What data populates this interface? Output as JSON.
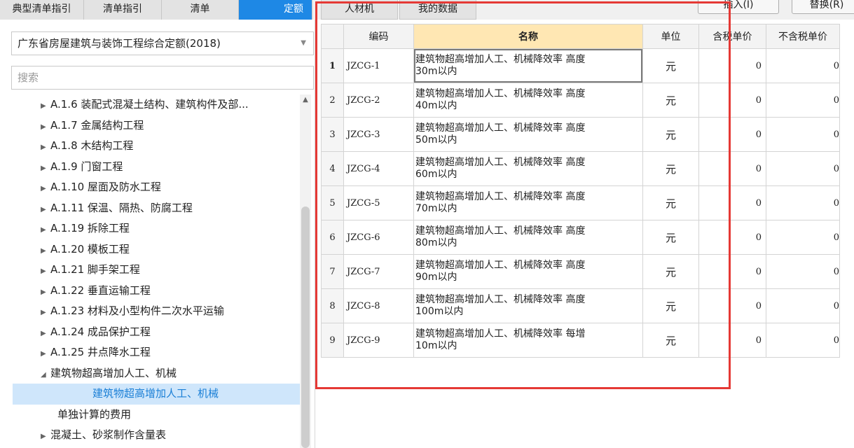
{
  "tabs_left": [
    "典型清单指引",
    "清单指引",
    "清单",
    "定额"
  ],
  "tabs_right": [
    "人材机",
    "我的数据"
  ],
  "buttons": {
    "insert": "插入(I)",
    "replace": "替换(R)"
  },
  "quota_library": {
    "selected": "广东省房屋建筑与装饰工程综合定额(2018)"
  },
  "search": {
    "placeholder": "搜索"
  },
  "tree": [
    {
      "label": "A.1.6 装配式混凝土结构、建筑构件及部...",
      "expandable": true
    },
    {
      "label": "A.1.7 金属结构工程",
      "expandable": true
    },
    {
      "label": "A.1.8 木结构工程",
      "expandable": true
    },
    {
      "label": "A.1.9 门窗工程",
      "expandable": true
    },
    {
      "label": "A.1.10 屋面及防水工程",
      "expandable": true
    },
    {
      "label": "A.1.11 保温、隔热、防腐工程",
      "expandable": true
    },
    {
      "label": "A.1.19 拆除工程",
      "expandable": true
    },
    {
      "label": "A.1.20 模板工程",
      "expandable": true
    },
    {
      "label": "A.1.21 脚手架工程",
      "expandable": true
    },
    {
      "label": "A.1.22 垂直运输工程",
      "expandable": true
    },
    {
      "label": "A.1.23 材料及小型构件二次水平运输",
      "expandable": true
    },
    {
      "label": "A.1.24 成品保护工程",
      "expandable": true
    },
    {
      "label": "A.1.25 井点降水工程",
      "expandable": true
    },
    {
      "label": "建筑物超高增加人工、机械",
      "expanded": true
    },
    {
      "label": "建筑物超高增加人工、机械",
      "selected": true
    },
    {
      "label": "单独计算的费用"
    },
    {
      "label": "混凝土、砂浆制作含量表",
      "expandable": true
    }
  ],
  "grid": {
    "columns": [
      "编码",
      "名称",
      "单位",
      "含税单价",
      "不含税单价"
    ],
    "rows": [
      {
        "no": "1",
        "code": "JZCG-1",
        "name1": "建筑物超高增加人工、机械降效率 高度",
        "name2": "30m以内",
        "unit": "元",
        "price_tax": "0",
        "price_notax": "0"
      },
      {
        "no": "2",
        "code": "JZCG-2",
        "name1": "建筑物超高增加人工、机械降效率 高度",
        "name2": "40m以内",
        "unit": "元",
        "price_tax": "0",
        "price_notax": "0"
      },
      {
        "no": "3",
        "code": "JZCG-3",
        "name1": "建筑物超高增加人工、机械降效率 高度",
        "name2": "50m以内",
        "unit": "元",
        "price_tax": "0",
        "price_notax": "0"
      },
      {
        "no": "4",
        "code": "JZCG-4",
        "name1": "建筑物超高增加人工、机械降效率 高度",
        "name2": "60m以内",
        "unit": "元",
        "price_tax": "0",
        "price_notax": "0"
      },
      {
        "no": "5",
        "code": "JZCG-5",
        "name1": "建筑物超高增加人工、机械降效率 高度",
        "name2": "70m以内",
        "unit": "元",
        "price_tax": "0",
        "price_notax": "0"
      },
      {
        "no": "6",
        "code": "JZCG-6",
        "name1": "建筑物超高增加人工、机械降效率 高度",
        "name2": "80m以内",
        "unit": "元",
        "price_tax": "0",
        "price_notax": "0"
      },
      {
        "no": "7",
        "code": "JZCG-7",
        "name1": "建筑物超高增加人工、机械降效率 高度",
        "name2": "90m以内",
        "unit": "元",
        "price_tax": "0",
        "price_notax": "0"
      },
      {
        "no": "8",
        "code": "JZCG-8",
        "name1": "建筑物超高增加人工、机械降效率 高度",
        "name2": "100m以内",
        "unit": "元",
        "price_tax": "0",
        "price_notax": "0"
      },
      {
        "no": "9",
        "code": "JZCG-9",
        "name1": "建筑物超高增加人工、机械降效率 每增",
        "name2": "10m以内",
        "unit": "元",
        "price_tax": "0",
        "price_notax": "0"
      }
    ]
  },
  "colors": {
    "active_tab": "#1e88e5",
    "selected_tree": "#cfe6fb",
    "header_highlight": "#ffe7b3",
    "annotation_box": "#e53935"
  }
}
